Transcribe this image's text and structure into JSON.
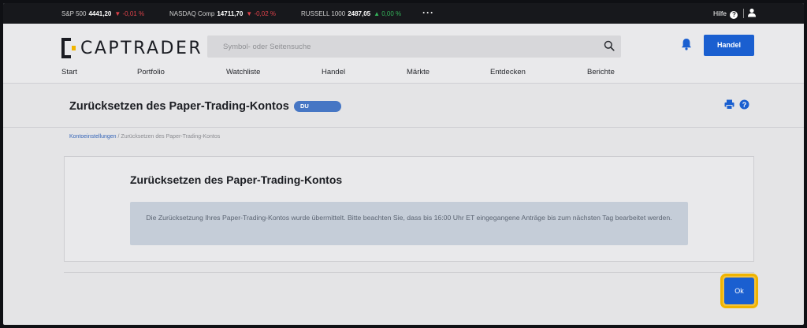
{
  "ticker": {
    "items": [
      {
        "name": "S&P 500",
        "value": "4441,20",
        "change": "▼ -0,01 %",
        "direction": "down"
      },
      {
        "name": "NASDAQ Comp",
        "value": "14711,70",
        "change": "▼ -0,02 %",
        "direction": "down"
      },
      {
        "name": "RUSSELL 1000",
        "value": "2487,05",
        "change": "▲ 0,00 %",
        "direction": "up"
      }
    ],
    "more": "···",
    "help_label": "Hilfe",
    "help_glyph": "?"
  },
  "header": {
    "logo_text": "CAPTRADER",
    "search_placeholder": "Symbol- oder Seitensuche",
    "trade_button": "Handel",
    "nav": [
      "Start",
      "Portfolio",
      "Watchliste",
      "Handel",
      "Märkte",
      "Entdecken",
      "Berichte"
    ]
  },
  "page": {
    "title": "Zurücksetzen des Paper-Trading-Kontos",
    "account_badge": "DU",
    "breadcrumb": {
      "link": "Kontoeinstellungen",
      "separator": "/",
      "current": "Zurücksetzen des Paper-Trading-Kontos"
    }
  },
  "card": {
    "title": "Zurücksetzen des Paper-Trading-Kontos",
    "message": "Die Zurücksetzung Ihres Paper-Trading-Kontos wurde übermittelt. Bitte beachten Sie, dass bis 16:00 Uhr ET eingegangene Anträge bis zum nächsten Tag bearbeitet werden."
  },
  "footer": {
    "ok_button": "Ok"
  },
  "colors": {
    "accent": "#1a5fd0",
    "highlight": "#f0b400",
    "down": "#e0424a",
    "up": "#34b45a"
  }
}
